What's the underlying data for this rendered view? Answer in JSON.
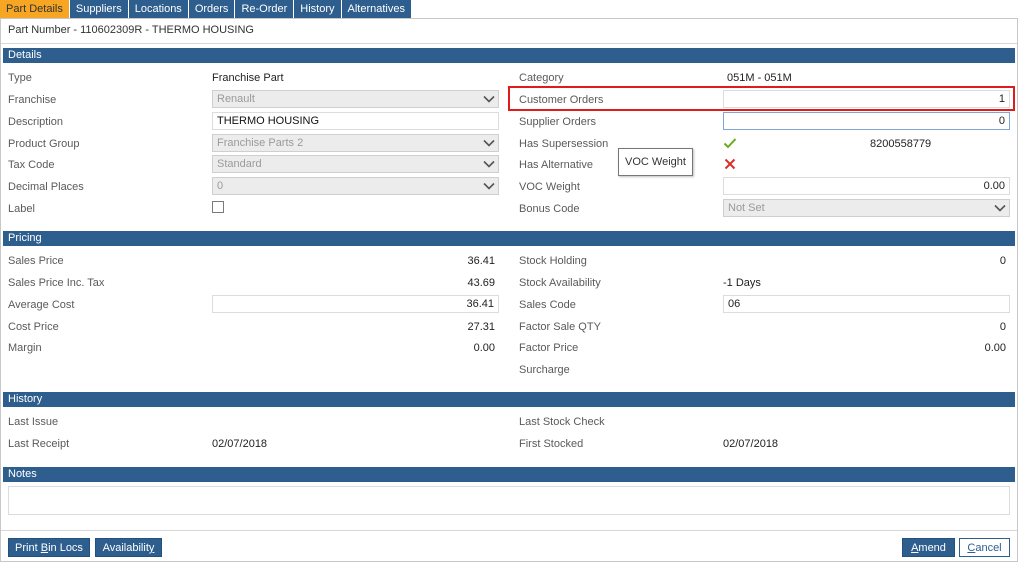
{
  "tabs": [
    "Part Details",
    "Suppliers",
    "Locations",
    "Orders",
    "Re-Order",
    "History",
    "Alternatives"
  ],
  "part_number": "Part Number - 110602309R - THERMO HOUSING",
  "sections": {
    "details": "Details",
    "pricing": "Pricing",
    "history": "History",
    "notes": "Notes"
  },
  "details": {
    "type_label": "Type",
    "type_value": "Franchise Part",
    "franchise_label": "Franchise",
    "franchise_value": "Renault",
    "description_label": "Description",
    "description_value": "THERMO HOUSING",
    "product_group_label": "Product Group",
    "product_group_value": "Franchise Parts 2",
    "tax_code_label": "Tax Code",
    "tax_code_value": "Standard",
    "decimal_places_label": "Decimal Places",
    "decimal_places_value": "0",
    "label_label": "Label",
    "category_label": "Category",
    "category_value": "051M - 051M",
    "customer_orders_label": "Customer Orders",
    "customer_orders_value": "1",
    "supplier_orders_label": "Supplier Orders",
    "supplier_orders_value": "0",
    "has_supersession_label": "Has Supersession",
    "supersession_value": "8200558779",
    "has_alternative_label": "Has Alternative",
    "voc_weight_label": "VOC Weight",
    "voc_weight_value": "0.00",
    "bonus_code_label": "Bonus Code",
    "bonus_code_value": "Not Set",
    "tooltip": "VOC Weight"
  },
  "pricing": {
    "sales_price_label": "Sales Price",
    "sales_price_value": "36.41",
    "sales_price_inc_tax_label": "Sales Price Inc. Tax",
    "sales_price_inc_tax_value": "43.69",
    "average_cost_label": "Average Cost",
    "average_cost_value": "36.41",
    "cost_price_label": "Cost Price",
    "cost_price_value": "27.31",
    "margin_label": "Margin",
    "margin_value": "0.00",
    "stock_holding_label": "Stock Holding",
    "stock_holding_value": "0",
    "stock_availability_label": "Stock Availability",
    "stock_availability_value": "-1 Days",
    "sales_code_label": "Sales Code",
    "sales_code_value": "06",
    "factor_sale_qty_label": "Factor Sale QTY",
    "factor_sale_qty_value": "0",
    "factor_price_label": "Factor Price",
    "factor_price_value": "0.00",
    "surcharge_label": "Surcharge"
  },
  "history": {
    "last_issue_label": "Last Issue",
    "last_receipt_label": "Last Receipt",
    "last_receipt_value": "02/07/2018",
    "last_stock_check_label": "Last Stock Check",
    "first_stocked_label": "First Stocked",
    "first_stocked_value": "02/07/2018"
  },
  "buttons": {
    "print_bin_locs_a": "Print ",
    "print_bin_locs_b": "B",
    "print_bin_locs_c": "in Locs",
    "availability_a": "Availabilit",
    "availability_b": "y",
    "amend_a": "A",
    "amend_b": "mend",
    "cancel_a": "C",
    "cancel_b": "ancel"
  },
  "icons": {
    "check": "checkmark-icon",
    "cross": "cross-icon",
    "chevron": "chevron-down-icon"
  },
  "colors": {
    "tab_active": "#f6a623",
    "header_blue": "#2e5e8e",
    "highlight_red": "#e01b1b",
    "check_green": "#6aaa1e",
    "cross_red": "#d9302b"
  }
}
